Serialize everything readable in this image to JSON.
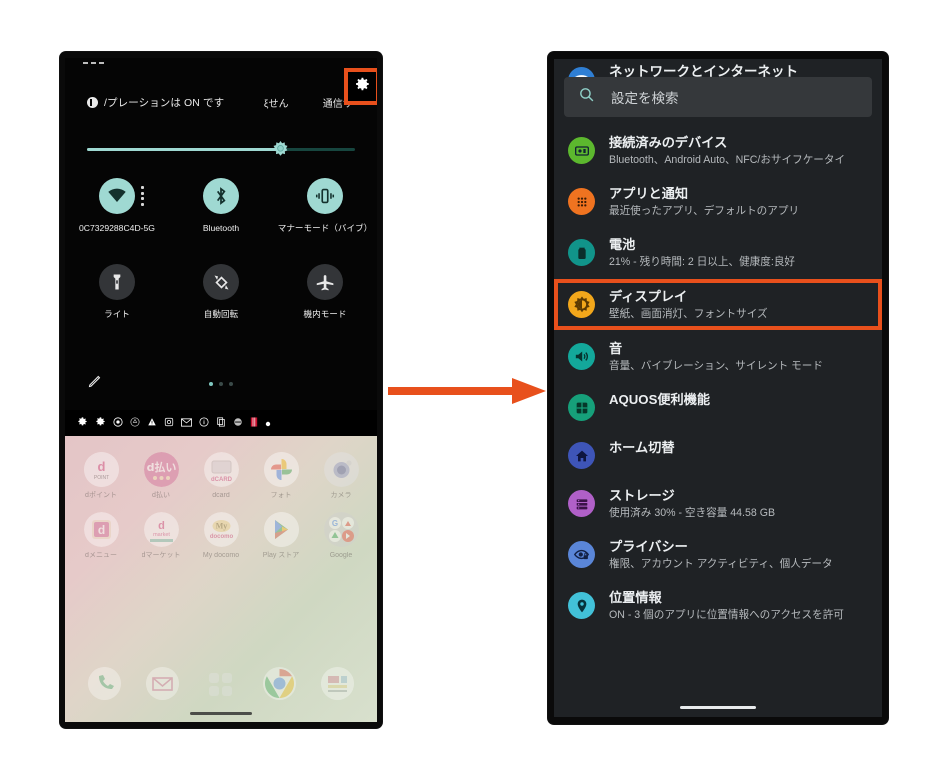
{
  "accent_orange": "#e8501c",
  "quick_settings": {
    "status_text": "/プレーションは ON です",
    "right_labels": [
      "ξせん",
      "通信サ"
    ],
    "dnd_icon": "do-not-disturb-icon",
    "brightness": {
      "icon": "brightness-icon",
      "value_percent": 72
    },
    "tiles": [
      {
        "label": "0C7329288C4D-5G",
        "icon": "wifi-icon",
        "state": "on"
      },
      {
        "label": "Bluetooth",
        "icon": "bluetooth-icon",
        "state": "on"
      },
      {
        "label": "マナーモード（バイブ）",
        "icon": "vibrate-icon",
        "state": "on"
      },
      {
        "label": "ライト",
        "icon": "flashlight-icon",
        "state": "off"
      },
      {
        "label": "自動回転",
        "icon": "auto-rotate-icon",
        "state": "off"
      },
      {
        "label": "機内モード",
        "icon": "airplane-icon",
        "state": "off"
      }
    ],
    "footer": {
      "edit_icon": "pencil-icon",
      "pages": 3,
      "active_page": 1,
      "settings_icon": "gear-icon",
      "settings_highlighted": true
    }
  },
  "home_screen": {
    "notification_icons": [
      "gear-icon",
      "gear-icon",
      "record-icon",
      "drive-icon",
      "warning-icon",
      "instagram-icon",
      "mail-icon",
      "info-icon",
      "copy-icon",
      "block-icon",
      "book-icon",
      "dot-icon"
    ],
    "apps_row1": [
      {
        "name": "dポイント",
        "icon": "dpoint-icon"
      },
      {
        "name": "d払い",
        "icon": "dpay-icon"
      },
      {
        "name": "dcard",
        "icon": "dcard-icon"
      },
      {
        "name": "フォト",
        "icon": "google-photos-icon"
      },
      {
        "name": "カメラ",
        "icon": "camera-icon"
      }
    ],
    "apps_row2": [
      {
        "name": "dメニュー",
        "icon": "dmenu-icon"
      },
      {
        "name": "dマーケット",
        "icon": "dmarket-icon"
      },
      {
        "name": "My docomo",
        "icon": "mydocomo-icon"
      },
      {
        "name": "Play ストア",
        "icon": "play-store-icon"
      },
      {
        "name": "Google",
        "icon": "google-folder-icon"
      }
    ],
    "dock": [
      {
        "name": "電話",
        "icon": "phone-icon"
      },
      {
        "name": "メール",
        "icon": "mail-icon"
      },
      {
        "name": "アプリ一覧",
        "icon": "app-drawer-icon"
      },
      {
        "name": "Chrome",
        "icon": "chrome-icon"
      },
      {
        "name": "ニュース",
        "icon": "news-icon"
      }
    ]
  },
  "settings": {
    "first_item_partial": {
      "title": "ネットワークとインターネット",
      "icon": "network-icon",
      "icon_color": "#2f7fd4"
    },
    "search": {
      "placeholder": "設定を検索",
      "icon": "search-icon"
    },
    "items": [
      {
        "title": "接続済みのデバイス",
        "subtitle": "Bluetooth、Android Auto、NFC/おサイフケータイ",
        "icon": "connected-devices-icon",
        "icon_color": "#5cb82e",
        "highlighted": false
      },
      {
        "title": "アプリと通知",
        "subtitle": "最近使ったアプリ、デフォルトのアプリ",
        "icon": "apps-notifications-icon",
        "icon_color": "#ef7320",
        "highlighted": false
      },
      {
        "title": "電池",
        "subtitle": "21% - 残り時間: 2 日以上、健康度:良好",
        "icon": "battery-icon",
        "icon_color": "#11948a",
        "highlighted": false
      },
      {
        "title": "ディスプレイ",
        "subtitle": "壁紙、画面消灯、フォントサイズ",
        "icon": "display-brightness-icon",
        "icon_color": "#f2a71b",
        "highlighted": true
      },
      {
        "title": "音",
        "subtitle": "音量、バイブレーション、サイレント モード",
        "icon": "sound-icon",
        "icon_color": "#13a89b",
        "highlighted": false
      },
      {
        "title": "AQUOS便利機能",
        "subtitle": "",
        "icon": "aquos-grid-icon",
        "icon_color": "#16a07a",
        "highlighted": false
      },
      {
        "title": "ホーム切替",
        "subtitle": "",
        "icon": "home-icon",
        "icon_color": "#3e55b8",
        "highlighted": false
      },
      {
        "title": "ストレージ",
        "subtitle": "使用済み 30% - 空き容量 44.58 GB",
        "icon": "storage-icon",
        "icon_color": "#b060c8",
        "highlighted": false
      },
      {
        "title": "プライバシー",
        "subtitle": "権限、アカウント アクティビティ、個人データ",
        "icon": "privacy-eye-icon",
        "icon_color": "#5a86d8",
        "highlighted": false
      },
      {
        "title": "位置情報",
        "subtitle": "ON - 3 個のアプリに位置情報へのアクセスを許可",
        "icon": "location-pin-icon",
        "icon_color": "#42c1d8",
        "highlighted": false
      }
    ]
  },
  "arrow": {
    "icon": "right-arrow-icon",
    "color": "#e8501c"
  }
}
